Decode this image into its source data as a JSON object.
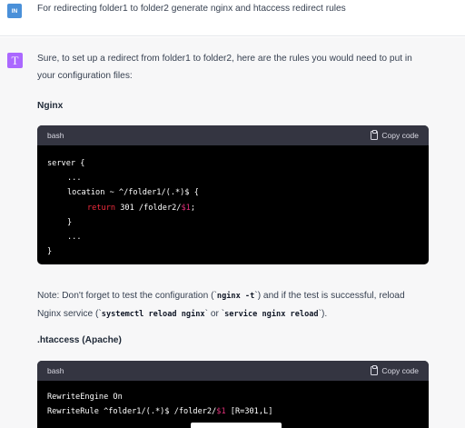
{
  "user": {
    "avatar_text": "IN",
    "message": "For redirecting folder1 to folder2 generate nginx and htaccess redirect rules"
  },
  "assistant": {
    "avatar_text": "T",
    "intro_line1": "Sure, to set up a redirect from folder1 to folder2, here are the rules you would need to put in",
    "intro_line2": "your configuration files:",
    "nginx_heading": "Nginx",
    "htaccess_heading": ".htaccess (Apache)",
    "copy_label": "Copy code",
    "nginx_block": {
      "lang": "bash",
      "lines": {
        "l1": "server {",
        "l2": "...",
        "l3": "location ~ ^/folder1/(.*)$ {",
        "l4_kw": "return",
        "l4_mid": " 301 /folder2/",
        "l4_var": "$1",
        "l4_end": ";",
        "l5": "}",
        "l6": "...",
        "l7": "}"
      }
    },
    "note": {
      "part1": "Note: Don't forget to test the configuration (`",
      "code1": "nginx -t",
      "part2": "`) and if the test is successful, reload",
      "part3": "Nginx service (`",
      "code2": "systemctl reload nginx",
      "part4": "` or `",
      "code3": "service nginx reload",
      "part5": "`)."
    },
    "htaccess_block": {
      "lang": "bash",
      "lines": {
        "l1": "RewriteEngine On",
        "l2_pre": "RewriteRule ^folder1/(.*)$ /folder2/",
        "l2_var": "$1",
        "l2_end": " [R=301,L]"
      }
    }
  }
}
